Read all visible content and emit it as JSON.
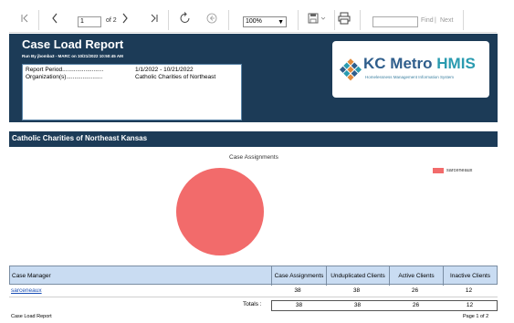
{
  "toolbar": {
    "first_page_icon": "first-page-icon",
    "prev_icon": "chevron-left-icon",
    "page_value": "1",
    "of_label": "of 2",
    "next_icon": "chevron-right-icon",
    "last_page_icon": "last-page-icon",
    "refresh_icon": "refresh-icon",
    "back_icon": "back-to-parent-icon",
    "zoom_value": "100%",
    "export_icon": "save-icon",
    "print_icon": "print-icon",
    "find_label": "Find",
    "separator": "|",
    "next_label": "Next"
  },
  "report": {
    "title": "Case Load Report",
    "run_by": "Run By jbomba3 - MARC on 10/21/2022 10:50:45 AM",
    "params": [
      {
        "label": "Report Period.........................",
        "value": "1/1/2022 - 10/21/2022"
      },
      {
        "label": "Organization(s)......................",
        "value": "Catholic Charities of Northeast"
      }
    ],
    "logo": {
      "kc": "KC Metro ",
      "hmis": "HMIS",
      "sub": "Homelessness Management Information System"
    },
    "org_header": "Catholic Charities of Northeast Kansas",
    "chart_title": "Case Assignments"
  },
  "chart_data": {
    "type": "pie",
    "title": "Case Assignments",
    "categories": [
      "sarceneaux"
    ],
    "values": [
      38
    ],
    "colors": [
      "#f26b6b"
    ],
    "legend_position": "top-right"
  },
  "table": {
    "columns": [
      "Case Manager",
      "Case Assignments",
      "Unduplicated Clients",
      "Active Clients",
      "Inactive Clients"
    ],
    "rows": [
      {
        "manager": "sarceneaux",
        "assignments": "38",
        "unduplicated": "38",
        "active": "26",
        "inactive": "12"
      }
    ],
    "totals_label": "Totals :",
    "totals": {
      "assignments": "38",
      "unduplicated": "38",
      "active": "26",
      "inactive": "12"
    }
  },
  "footer": {
    "left": "Case Load Report",
    "right": "Page 1 of 2"
  },
  "colors": {
    "header_band": "#1c3b57",
    "table_header": "#c9dcf2",
    "pie_slice": "#f26b6b",
    "link": "#1a4fb5"
  }
}
